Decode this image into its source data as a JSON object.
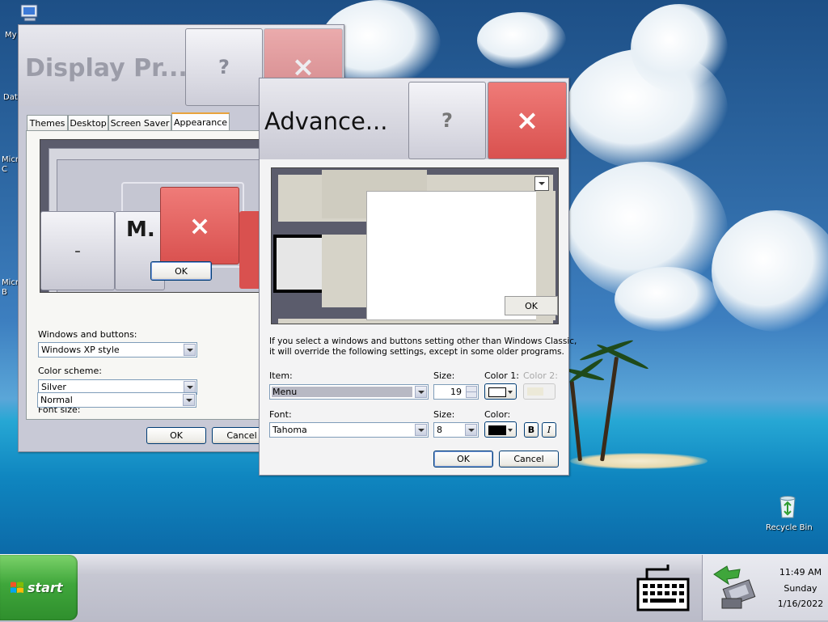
{
  "desktop": {
    "icons": [
      {
        "label": "My",
        "icon": "my-computer-icon"
      },
      {
        "label": "Date",
        "icon": "file-icon"
      },
      {
        "label": "Micro\nC",
        "icon": "app-icon"
      },
      {
        "label": "Micro\nB",
        "icon": "app-icon"
      },
      {
        "label": "Recycle Bin",
        "icon": "recycle-bin-icon"
      }
    ]
  },
  "display_window": {
    "title": "Display Pr...",
    "help_glyph": "?",
    "close_glyph": "×",
    "tabs": [
      "Themes",
      "Desktop",
      "Screen Saver",
      "Appearance"
    ],
    "active_tab": "Appearance",
    "preview": {
      "minimize_glyph": "‑",
      "title_initial": "M.",
      "close_glyph": "×",
      "ok_label": "OK"
    },
    "windows_buttons_label": "Windows and buttons:",
    "windows_buttons_value": "Windows XP style",
    "color_scheme_label": "Color scheme:",
    "color_scheme_value": "Silver",
    "font_size_label": "Font size:",
    "font_size_value": "Normal",
    "ok_label": "OK",
    "cancel_label": "Cancel"
  },
  "advanced_window": {
    "title": "Advance...",
    "help_glyph": "?",
    "close_glyph": "×",
    "preview_ok_label": "OK",
    "info_text_1": "If you select a windows and buttons setting other than Windows Classic,",
    "info_text_2": "it will override the following settings, except in some older programs.",
    "item_label": "Item:",
    "item_value": "Menu",
    "size_label": "Size:",
    "item_size_value": "19",
    "color1_label": "Color 1:",
    "color2_label": "Color 2:",
    "font_label": "Font:",
    "font_value": "Tahoma",
    "font_size_label": "Size:",
    "font_size_value": "8",
    "font_color_label": "Color:",
    "bold_label": "B",
    "italic_label": "I",
    "ok_label": "OK",
    "cancel_label": "Cancel",
    "colors": {
      "color1": "#ffffff",
      "font_color": "#000000",
      "color2": "#ece9d8"
    }
  },
  "taskbar": {
    "start_label": "start",
    "clock_time": "11:49 AM",
    "clock_day": "Sunday",
    "clock_date": "1/16/2022",
    "tray_icons": [
      "keyboard-icon",
      "network-icon"
    ]
  }
}
